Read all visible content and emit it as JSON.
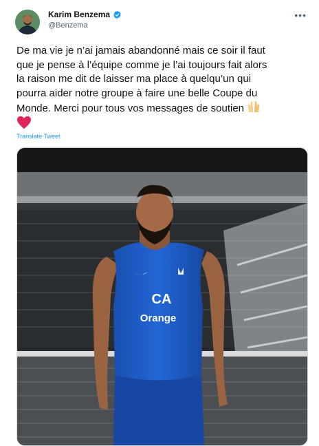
{
  "author": {
    "name": "Karim Benzema",
    "handle": "@Benzema",
    "verified_icon": "verified-badge-icon"
  },
  "tweet": {
    "text_lines": [
      "De ma vie je n’ai jamais abandonné mais ce soir il faut",
      "que je pense à l’équipe comme je l’ai toujours fait alors",
      "la raison me dit de laisser ma place à quelqu’un qui",
      "pourra aider notre groupe à faire une belle Coupe du",
      "Monde. Merci pour tous vos messages de soutien"
    ],
    "emojis": [
      "raised-hands-icon",
      "red-heart-icon"
    ],
    "translate_label": "Translate Tweet"
  },
  "media": {
    "jersey_text": "Orange"
  },
  "colors": {
    "accent": "#1d9bf0",
    "text": "#0f1419",
    "muted": "#536471",
    "jersey": "#1e5bc6"
  }
}
